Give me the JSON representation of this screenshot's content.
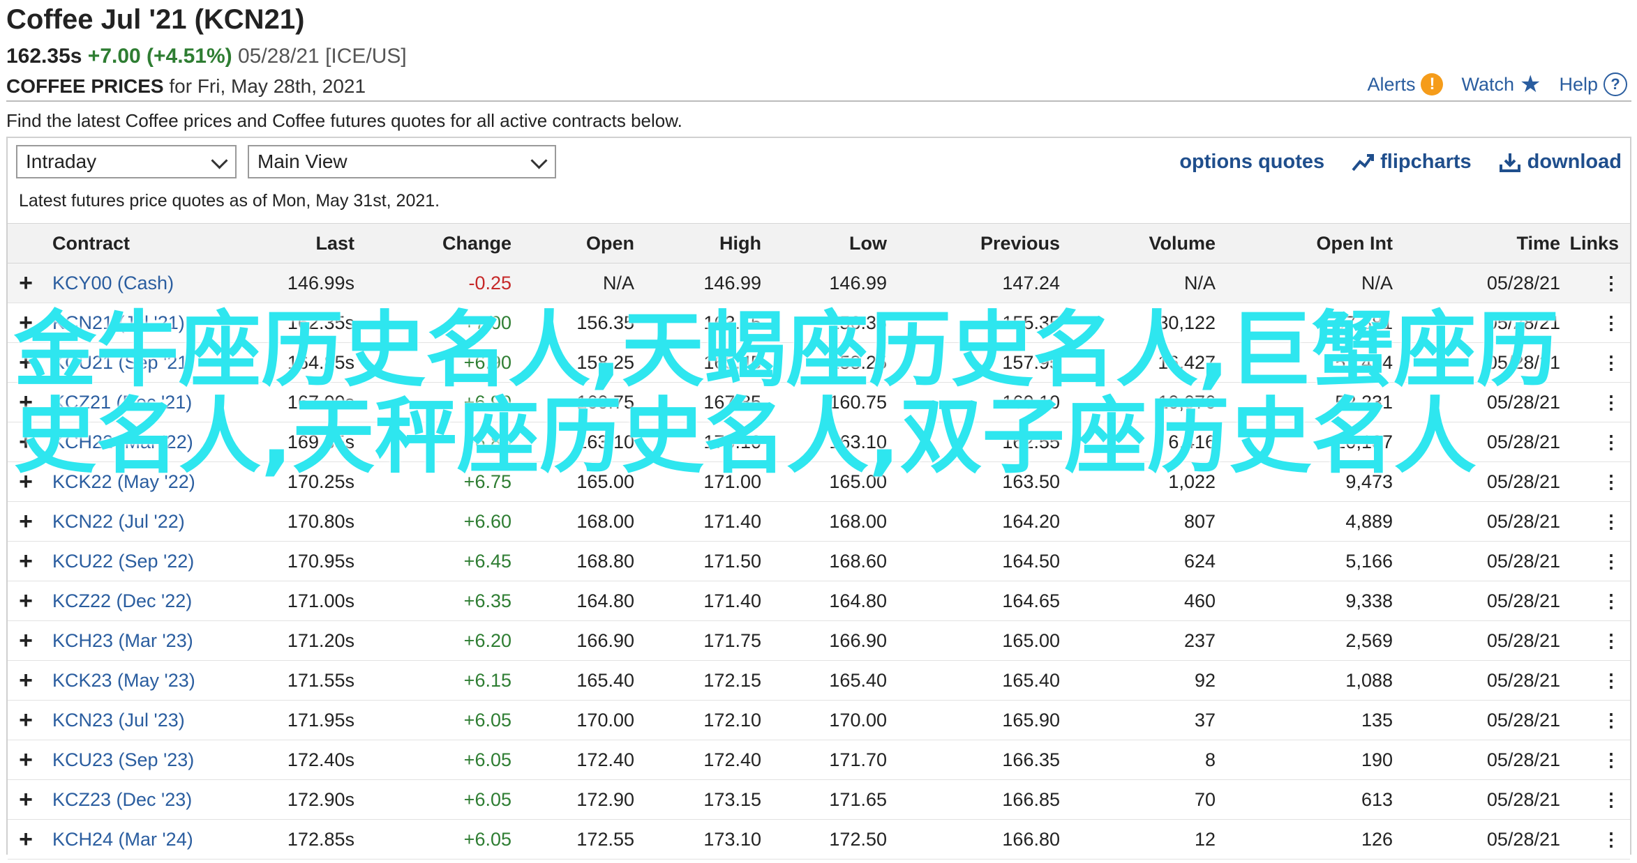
{
  "header": {
    "title": "Coffee Jul '21 (KCN21)",
    "last": "162.35s",
    "change": "+7.00 (+4.51%)",
    "meta": "05/28/21 [ICE/US]",
    "prices_label": "COFFEE PRICES",
    "prices_for": "for Fri, May 28th, 2021"
  },
  "actions": {
    "alerts": "Alerts",
    "watch": "Watch",
    "help": "Help"
  },
  "intro": "Find the latest Coffee prices and Coffee futures quotes for all active contracts below.",
  "controls": {
    "period": "Intraday",
    "view": "Main View",
    "options_quotes": "options quotes",
    "flipcharts": "flipcharts",
    "download": "download"
  },
  "asof": "Latest futures price quotes as of Mon, May 31st, 2021.",
  "columns": {
    "contract": "Contract",
    "last": "Last",
    "change": "Change",
    "open": "Open",
    "high": "High",
    "low": "Low",
    "previous": "Previous",
    "volume": "Volume",
    "open_int": "Open Int",
    "time": "Time",
    "links": "Links"
  },
  "rows": [
    {
      "contract": "KCY00 (Cash)",
      "last": "146.99s",
      "change": "-0.25",
      "open": "N/A",
      "high": "146.99",
      "low": "146.99",
      "previous": "147.24",
      "volume": "N/A",
      "open_int": "N/A",
      "time": "05/28/21"
    },
    {
      "contract": "KCN21 (Jul '21)",
      "last": "162.35s",
      "change": "+7.00",
      "open": "156.35",
      "high": "163.15",
      "low": "156.35",
      "previous": "155.35",
      "volume": "30,122",
      "open_int": "97,881",
      "time": "05/28/21"
    },
    {
      "contract": "KCU21 (Sep '21)",
      "last": "164.85s",
      "change": "+6.90",
      "open": "158.25",
      "high": "165.45",
      "low": "158.25",
      "previous": "157.95",
      "volume": "16,427",
      "open_int": "57,424",
      "time": "05/28/21"
    },
    {
      "contract": "KCZ21 (Dec '21)",
      "last": "167.00s",
      "change": "+6.90",
      "open": "160.75",
      "high": "167.85",
      "low": "160.75",
      "previous": "160.10",
      "volume": "10,076",
      "open_int": "52,231",
      "time": "05/28/21"
    },
    {
      "contract": "KCH22 (Mar '22)",
      "last": "169.35s",
      "change": "+6.80",
      "open": "163.10",
      "high": "170.10",
      "low": "163.10",
      "previous": "162.55",
      "volume": "6,416",
      "open_int": "20,187",
      "time": "05/28/21"
    },
    {
      "contract": "KCK22 (May '22)",
      "last": "170.25s",
      "change": "+6.75",
      "open": "165.00",
      "high": "171.00",
      "low": "165.00",
      "previous": "163.50",
      "volume": "1,022",
      "open_int": "9,473",
      "time": "05/28/21"
    },
    {
      "contract": "KCN22 (Jul '22)",
      "last": "170.80s",
      "change": "+6.60",
      "open": "168.00",
      "high": "171.40",
      "low": "168.00",
      "previous": "164.20",
      "volume": "807",
      "open_int": "4,889",
      "time": "05/28/21"
    },
    {
      "contract": "KCU22 (Sep '22)",
      "last": "170.95s",
      "change": "+6.45",
      "open": "168.80",
      "high": "171.50",
      "low": "168.60",
      "previous": "164.50",
      "volume": "624",
      "open_int": "5,166",
      "time": "05/28/21"
    },
    {
      "contract": "KCZ22 (Dec '22)",
      "last": "171.00s",
      "change": "+6.35",
      "open": "164.80",
      "high": "171.40",
      "low": "164.80",
      "previous": "164.65",
      "volume": "460",
      "open_int": "9,338",
      "time": "05/28/21"
    },
    {
      "contract": "KCH23 (Mar '23)",
      "last": "171.20s",
      "change": "+6.20",
      "open": "166.90",
      "high": "171.75",
      "low": "166.90",
      "previous": "165.00",
      "volume": "237",
      "open_int": "2,569",
      "time": "05/28/21"
    },
    {
      "contract": "KCK23 (May '23)",
      "last": "171.55s",
      "change": "+6.15",
      "open": "165.40",
      "high": "172.15",
      "low": "165.40",
      "previous": "165.40",
      "volume": "92",
      "open_int": "1,088",
      "time": "05/28/21"
    },
    {
      "contract": "KCN23 (Jul '23)",
      "last": "171.95s",
      "change": "+6.05",
      "open": "170.00",
      "high": "172.10",
      "low": "170.00",
      "previous": "165.90",
      "volume": "37",
      "open_int": "135",
      "time": "05/28/21"
    },
    {
      "contract": "KCU23 (Sep '23)",
      "last": "172.40s",
      "change": "+6.05",
      "open": "172.40",
      "high": "172.40",
      "low": "171.70",
      "previous": "166.35",
      "volume": "8",
      "open_int": "190",
      "time": "05/28/21"
    },
    {
      "contract": "KCZ23 (Dec '23)",
      "last": "172.90s",
      "change": "+6.05",
      "open": "172.90",
      "high": "173.15",
      "low": "171.65",
      "previous": "166.85",
      "volume": "70",
      "open_int": "613",
      "time": "05/28/21"
    },
    {
      "contract": "KCH24 (Mar '24)",
      "last": "172.85s",
      "change": "+6.05",
      "open": "172.55",
      "high": "173.10",
      "low": "172.50",
      "previous": "166.80",
      "volume": "12",
      "open_int": "126",
      "time": "05/28/21"
    }
  ],
  "overlay_text": "金牛座历史名人,天蝎座历史名人,巨蟹座历史名人,天秤座历史名人,双子座历史名人",
  "colors": {
    "link": "#2a5d9f",
    "positive": "#2e7d32",
    "negative": "#c62828",
    "overlay": "#2ee6ef",
    "alert": "#f59c1a"
  }
}
